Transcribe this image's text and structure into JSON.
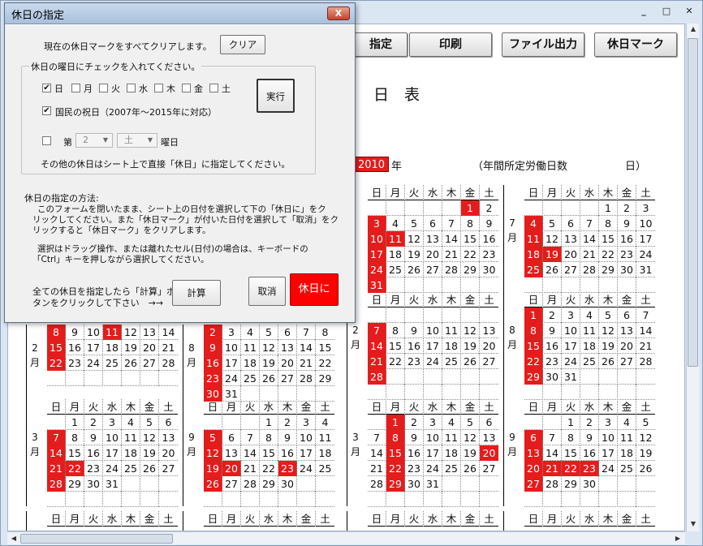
{
  "window": {
    "minimize": "_",
    "maximize": "□",
    "close": "✕"
  },
  "sheet": {
    "buttons": [
      "指定",
      "印刷",
      "ファイル出力",
      "休日マーク"
    ],
    "title": "日　表",
    "year": "2010",
    "year_suffix": "年",
    "annual_label": "（年間所定労働日数",
    "annual_suffix": "日）"
  },
  "dialog": {
    "title": "休日の指定",
    "close": "X",
    "clear_text": "現在の休日マークをすべてクリアします。",
    "clear_button": "クリア",
    "group_label": "休日の曜日にチェックを入れてください。",
    "weekdays": [
      {
        "label": "日",
        "checked": true
      },
      {
        "label": "月",
        "checked": false
      },
      {
        "label": "火",
        "checked": false
      },
      {
        "label": "水",
        "checked": false
      },
      {
        "label": "木",
        "checked": false
      },
      {
        "label": "金",
        "checked": false
      },
      {
        "label": "土",
        "checked": false
      }
    ],
    "check_mark": "✔",
    "national_label": "国民の祝日（2007年～2015年に対応）",
    "execute_button": "実行",
    "nth_prefix": "第",
    "nth_value": "2",
    "nth_weekday": "土",
    "nth_suffix": "曜日",
    "other_text": "その他の休日はシート上で直接「休日」に指定してください。",
    "method_title": "休日の指定の方法:",
    "method_lines": [
      "このフォームを閉いたまま、シート上の日付を選択して下の「休日に」をク",
      "リックしてください。また「休日マーク」が付いた日付を選択して「取消」をク",
      "リックすると「休日マーク」をクリアします。"
    ],
    "select_lines": [
      "選択はドラッグ操作、または離れたセル(日付)の場合は、キーボードの",
      "「Ctrl」キーを押しながら選択してください。"
    ],
    "calc_lines": [
      "全ての休日を指定したら「計算」ボ",
      "タンをクリックして下さい　→→"
    ],
    "calc_button": "計算",
    "cancel_button": "取消",
    "holiday_button": "休日に"
  },
  "weekday_header": [
    "日",
    "月",
    "火",
    "水",
    "木",
    "金",
    "土"
  ],
  "calendars": [
    {
      "month_label": "",
      "rows": [
        [
          "",
          "",
          "",
          "",
          "",
          "1",
          "2"
        ],
        [
          "3",
          "4",
          "5",
          "6",
          "7",
          "8",
          "9"
        ],
        [
          "10",
          "11",
          "12",
          "13",
          "14",
          "15",
          "16"
        ],
        [
          "17",
          "18",
          "19",
          "20",
          "21",
          "22",
          "23"
        ],
        [
          "24",
          "25",
          "26",
          "27",
          "28",
          "29",
          "30"
        ],
        [
          "31",
          "",
          "",
          "",
          "",
          "",
          ""
        ]
      ],
      "holidays": [
        "1",
        "3",
        "10",
        "11",
        "17",
        "24",
        "31"
      ],
      "has_header": true
    },
    {
      "month_label": "7月",
      "rows": [
        [
          "",
          "",
          "",
          "",
          "1",
          "2",
          "3"
        ],
        [
          "4",
          "5",
          "6",
          "7",
          "8",
          "9",
          "10"
        ],
        [
          "11",
          "12",
          "13",
          "14",
          "15",
          "16",
          "17"
        ],
        [
          "18",
          "19",
          "20",
          "21",
          "22",
          "23",
          "24"
        ],
        [
          "25",
          "26",
          "27",
          "28",
          "29",
          "30",
          "31"
        ],
        [
          "",
          "",
          "",
          "",
          "",
          "",
          ""
        ]
      ],
      "holidays": [
        "4",
        "11",
        "18",
        "19",
        "25"
      ],
      "has_header": true
    },
    {
      "month_label": "2月",
      "rows": [
        [
          "",
          "",
          "",
          "",
          "",
          "",
          ""
        ],
        [
          "7",
          "8",
          "9",
          "10",
          "11",
          "12",
          "13"
        ],
        [
          "14",
          "15",
          "16",
          "17",
          "18",
          "19",
          "20"
        ],
        [
          "21",
          "22",
          "23",
          "24",
          "25",
          "26",
          "27"
        ],
        [
          "28",
          "",
          "",
          "",
          "",
          "",
          ""
        ],
        [
          "",
          "",
          "",
          "",
          "",
          "",
          ""
        ]
      ],
      "holidays": [
        "7",
        "14",
        "21",
        "28"
      ],
      "has_header": true,
      "hidden_rows": 2
    },
    {
      "month_label": "8月",
      "rows": [
        [
          "1",
          "2",
          "3",
          "4",
          "5",
          "6",
          "7"
        ],
        [
          "8",
          "9",
          "10",
          "11",
          "12",
          "13",
          "14"
        ],
        [
          "15",
          "16",
          "17",
          "18",
          "19",
          "20",
          "21"
        ],
        [
          "22",
          "23",
          "24",
          "25",
          "26",
          "27",
          "28"
        ],
        [
          "29",
          "30",
          "31",
          "",
          "",
          "",
          ""
        ],
        [
          "",
          "",
          "",
          "",
          "",
          "",
          ""
        ]
      ],
      "holidays": [
        "1",
        "8",
        "15",
        "22",
        "29"
      ],
      "has_header": true
    },
    {
      "month_label": "2月",
      "rows": [
        [
          "8",
          "9",
          "10",
          "11",
          "12",
          "13",
          "14"
        ],
        [
          "15",
          "16",
          "17",
          "18",
          "19",
          "20",
          "21"
        ],
        [
          "22",
          "23",
          "24",
          "25",
          "26",
          "27",
          "28"
        ],
        [
          "",
          "",
          "",
          "",
          "",
          "",
          ""
        ]
      ],
      "holidays": [
        "8",
        "11",
        "15",
        "22"
      ],
      "has_header": false
    },
    {
      "month_label": "8月",
      "rows": [
        [
          "2",
          "3",
          "4",
          "5",
          "6",
          "7",
          "8"
        ],
        [
          "9",
          "10",
          "11",
          "12",
          "13",
          "14",
          "15"
        ],
        [
          "16",
          "17",
          "18",
          "19",
          "20",
          "21",
          "22"
        ],
        [
          "23",
          "24",
          "25",
          "26",
          "27",
          "28",
          "29"
        ],
        [
          "30",
          "31",
          "",
          "",
          "",
          "",
          ""
        ]
      ],
      "holidays": [
        "2",
        "9",
        "16",
        "23",
        "30"
      ],
      "has_header": false
    },
    {
      "month_label": "3月",
      "rows": [
        [
          "",
          "1",
          "2",
          "3",
          "4",
          "5",
          "6"
        ],
        [
          "7",
          "8",
          "9",
          "10",
          "11",
          "12",
          "13"
        ],
        [
          "14",
          "15",
          "16",
          "17",
          "18",
          "19",
          "20"
        ],
        [
          "21",
          "22",
          "23",
          "24",
          "25",
          "26",
          "27"
        ],
        [
          "28",
          "29",
          "30",
          "31",
          "",
          "",
          ""
        ],
        [
          "",
          "",
          "",
          "",
          "",
          "",
          ""
        ]
      ],
      "holidays": [
        "7",
        "14",
        "21",
        "22",
        "28"
      ],
      "has_header": true
    },
    {
      "month_label": "9月",
      "rows": [
        [
          "",
          "",
          "",
          "1",
          "2",
          "3",
          "4"
        ],
        [
          "5",
          "6",
          "7",
          "8",
          "9",
          "10",
          "11"
        ],
        [
          "12",
          "13",
          "14",
          "15",
          "16",
          "17",
          "18"
        ],
        [
          "19",
          "20",
          "21",
          "22",
          "23",
          "24",
          "25"
        ],
        [
          "26",
          "27",
          "28",
          "29",
          "30",
          "",
          ""
        ],
        [
          "",
          "",
          "",
          "",
          "",
          "",
          ""
        ]
      ],
      "holidays": [
        "5",
        "12",
        "19",
        "20",
        "23",
        "26"
      ],
      "has_header": true
    },
    {
      "month_label": "3月",
      "rows": [
        [
          "",
          "1",
          "2",
          "3",
          "4",
          "5",
          "6"
        ],
        [
          "7",
          "8",
          "9",
          "10",
          "11",
          "12",
          "13"
        ],
        [
          "14",
          "15",
          "16",
          "17",
          "18",
          "19",
          "20"
        ],
        [
          "21",
          "22",
          "23",
          "24",
          "25",
          "26",
          "27"
        ],
        [
          "28",
          "29",
          "30",
          "31",
          "",
          "",
          ""
        ],
        [
          "",
          "",
          "",
          "",
          "",
          "",
          ""
        ]
      ],
      "holidays": [
        "1",
        "8",
        "15",
        "20",
        "22",
        "29"
      ],
      "has_header": true
    },
    {
      "month_label": "9月",
      "rows": [
        [
          "",
          "",
          "1",
          "2",
          "3",
          "4",
          "5"
        ],
        [
          "6",
          "7",
          "8",
          "9",
          "10",
          "11",
          "12"
        ],
        [
          "13",
          "14",
          "15",
          "16",
          "17",
          "18",
          "19"
        ],
        [
          "20",
          "21",
          "22",
          "23",
          "24",
          "25",
          "26"
        ],
        [
          "27",
          "28",
          "29",
          "30",
          "",
          "",
          ""
        ],
        [
          "",
          "",
          "",
          "",
          "",
          "",
          ""
        ]
      ],
      "holidays": [
        "6",
        "13",
        "20",
        "21",
        "22",
        "23",
        "27"
      ],
      "has_header": true
    }
  ],
  "bottom_row_partial": [
    "",
    "",
    "",
    "",
    "",
    "",
    "",
    ""
  ]
}
